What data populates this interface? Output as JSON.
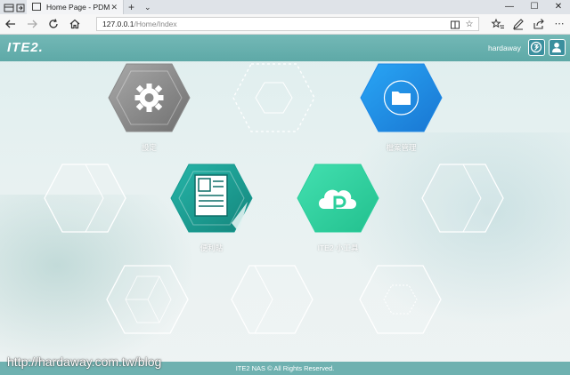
{
  "browser": {
    "tab_title": "Home Page - PDM",
    "tab_close": "✕",
    "new_tab": "+",
    "tab_menu": "⌄",
    "address_host": "127.0.0.1",
    "address_path": "/Home/Index",
    "window_controls": [
      "—",
      "☐",
      "✕"
    ]
  },
  "header": {
    "logo": "ITE2.",
    "username": "hardaway"
  },
  "tiles": [
    {
      "name": "settings",
      "label": "設定",
      "style": "gray"
    },
    {
      "name": "empty-1",
      "label": "",
      "style": "outline"
    },
    {
      "name": "file-manager",
      "label": "檔案管理",
      "style": "blue"
    },
    {
      "name": "empty-2",
      "label": "",
      "style": "outline"
    },
    {
      "name": "notes",
      "label": "便利貼",
      "style": "teal"
    },
    {
      "name": "ite2-cloud",
      "label": "ITE2 小工具",
      "style": "green"
    },
    {
      "name": "empty-3",
      "label": "",
      "style": "outline"
    },
    {
      "name": "empty-4",
      "label": "",
      "style": "outline"
    },
    {
      "name": "empty-5",
      "label": "",
      "style": "outline"
    },
    {
      "name": "empty-6",
      "label": "",
      "style": "outline"
    }
  ],
  "footer": {
    "copyright": "ITE2 NAS © All Rights Reserved."
  },
  "watermark": "http://hardaway.com.tw/blog",
  "colors": {
    "header": "#5ea9a7",
    "settings_tile": "#8a8a8a",
    "files_tile": "#2196e8",
    "notes_tile": "#1aa39a",
    "cloud_tile": "#2fd6a3"
  }
}
